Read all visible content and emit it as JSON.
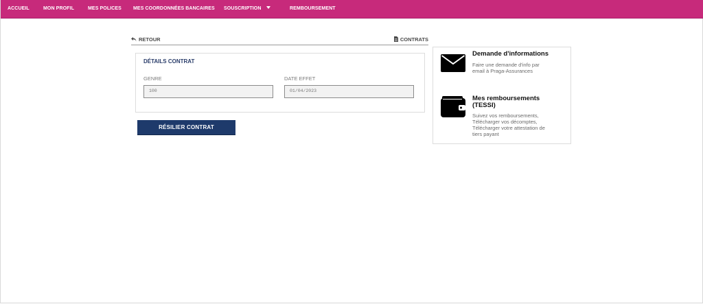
{
  "nav": {
    "items": [
      {
        "label": "ACCUEIL"
      },
      {
        "label": "MON PROFIL"
      },
      {
        "label": "MES POLICES"
      },
      {
        "label": "MES COORDONNÉES BANCAIRES"
      },
      {
        "label": "SOUSCRIPTION"
      },
      {
        "label": "REMBOURSEMENT"
      }
    ]
  },
  "toolbar": {
    "back_label": "RETOUR",
    "contracts_label": "CONTRATS"
  },
  "details": {
    "title": "DÉTAILS CONTRAT",
    "genre": {
      "label": "GENRE",
      "value": "100"
    },
    "date_effet": {
      "label": "DATE EFFET",
      "value": "01/04/2023"
    }
  },
  "actions": {
    "resilier_label": "RÉSILIER CONTRAT"
  },
  "side": {
    "info_request": {
      "title": "Demande d'informations",
      "desc_line1": "Faire une demande d'info par",
      "desc_line2": "email à Praga-Assurances",
      "icon": "envelope-icon"
    },
    "reimbursements": {
      "title_line1": "Mes remboursements",
      "title_line2": "(TESSI)",
      "desc_line1": "Suivez vos remboursements,",
      "desc_line2": "Télécharger vos décomptes,",
      "desc_line3": "Télécharger votre attestation de",
      "desc_line4": "tiers payant",
      "icon": "wallet-icon"
    }
  },
  "colors": {
    "nav_bg": "#c72a7b",
    "button_bg": "#1e3a6b"
  }
}
